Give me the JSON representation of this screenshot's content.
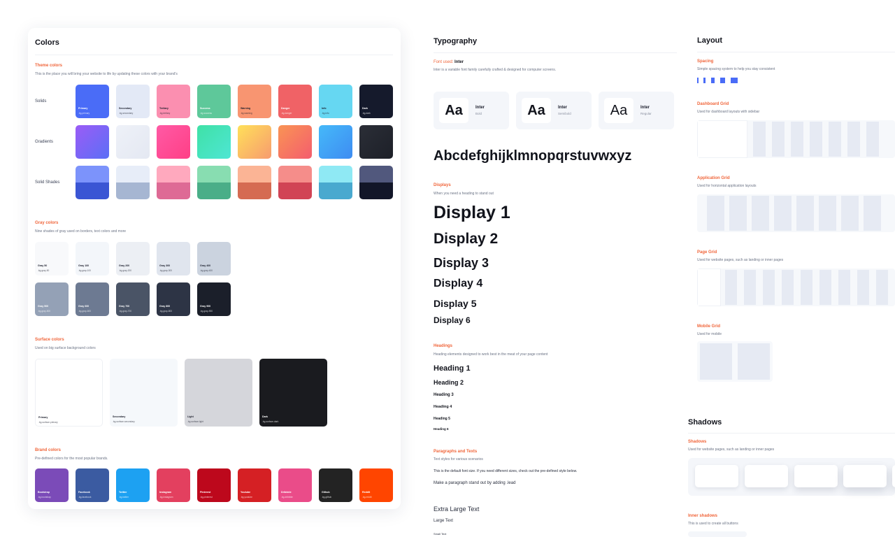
{
  "colors": {
    "title": "Colors",
    "theme": {
      "title": "Theme colors",
      "desc": "This is the place you will bring your website to life by updating these colors with your brand's",
      "row_labels": [
        "Solids",
        "Gradients",
        "Solid Shades"
      ],
      "solids": [
        {
          "name": "Primary",
          "code": ".bg-primary",
          "color": "#4a6cf7"
        },
        {
          "name": "Secondary",
          "code": ".bg-secondary",
          "color": "#e3e9f6"
        },
        {
          "name": "Tertiary",
          "code": ".bg-tertiary",
          "color": "#fb8fb0"
        },
        {
          "name": "Success",
          "code": ".bg-success",
          "color": "#5ec89a"
        },
        {
          "name": "Warning",
          "code": ".bg-warning",
          "color": "#f89571"
        },
        {
          "name": "Danger",
          "code": ".bg-danger",
          "color": "#f06266"
        },
        {
          "name": "Info",
          "code": ".bg-info",
          "color": "#66d7f2"
        },
        {
          "name": "Dark",
          "code": ".bg-dark",
          "color": "#151a2c"
        }
      ],
      "gradients": [
        {
          "from": "#9b5cf6",
          "to": "#5b6ff6"
        },
        {
          "from": "#eef1f8",
          "to": "#e4e8f2"
        },
        {
          "from": "#ff5aa5",
          "to": "#ff3f86"
        },
        {
          "from": "#3fe1a6",
          "to": "#4ee6d4"
        },
        {
          "from": "#ffe059",
          "to": "#f79b6f"
        },
        {
          "from": "#f99454",
          "to": "#f45d6e"
        },
        {
          "from": "#45b9f9",
          "to": "#3e8cf2"
        },
        {
          "from": "#2b2e37",
          "to": "#1d2028"
        }
      ],
      "shades": [
        {
          "top": "#7c93fb",
          "bottom": "#3a55d4"
        },
        {
          "top": "#e7edf8",
          "bottom": "#a6b6d2"
        },
        {
          "top": "#ffa9be",
          "bottom": "#de6a95"
        },
        {
          "top": "#88ddb1",
          "bottom": "#4aae88"
        },
        {
          "top": "#fbb495",
          "bottom": "#d56b52"
        },
        {
          "top": "#f58d8a",
          "bottom": "#d14455"
        },
        {
          "top": "#8fe9f4",
          "bottom": "#49a9cf"
        },
        {
          "top": "#51587d",
          "bottom": "#121628"
        }
      ]
    },
    "gray": {
      "title": "Gray colors",
      "desc": "Nine shades of gray used on borders, text colors and more",
      "items": [
        {
          "name": "Gray 50",
          "code": ".bg-gray-50",
          "color": "#f8f9fb"
        },
        {
          "name": "Gray 100",
          "code": ".bg-gray-100",
          "color": "#f3f6fa"
        },
        {
          "name": "Gray 200",
          "code": ".bg-gray-200",
          "color": "#eceff4"
        },
        {
          "name": "Gray 300",
          "code": ".bg-gray-300",
          "color": "#e0e5ee"
        },
        {
          "name": "Gray 400",
          "code": ".bg-gray-400",
          "color": "#cbd3df"
        },
        {
          "name": "Gray 500",
          "code": ".bg-gray-500",
          "color": "#94a1b6"
        },
        {
          "name": "Gray 600",
          "code": ".bg-gray-600",
          "color": "#6d7a92"
        },
        {
          "name": "Gray 700",
          "code": ".bg-gray-700",
          "color": "#4a5466"
        },
        {
          "name": "Gray 800",
          "code": ".bg-gray-800",
          "color": "#2d3445"
        },
        {
          "name": "Gray 900",
          "code": ".bg-gray-900",
          "color": "#1b1f2a"
        }
      ]
    },
    "surface": {
      "title": "Surface colors",
      "desc": "Used on big surface background colors",
      "items": [
        {
          "name": "Primary",
          "code": ".bg-surface-primary",
          "color": "#ffffff"
        },
        {
          "name": "Secondary",
          "code": ".bg-surface-secondary",
          "color": "#f5f8fb"
        },
        {
          "name": "Light",
          "code": ".bg-surface-light",
          "color": "#d5d6db"
        },
        {
          "name": "Dark",
          "code": ".bg-surface-dark",
          "color": "#1a1b1f"
        }
      ]
    },
    "brand": {
      "title": "Brand colors",
      "desc": "Pre-defined colors for the most popular brands.",
      "items": [
        {
          "name": "Bootstrap",
          "code": ".bg-bootstrap",
          "color": "#7b4bb8"
        },
        {
          "name": "Facebook",
          "code": ".bg-facebook",
          "color": "#3b5ba1"
        },
        {
          "name": "Twitter",
          "code": ".bg-twitter",
          "color": "#1da1f2"
        },
        {
          "name": "Instagram",
          "code": ".bg-instagram",
          "color": "#e3405f"
        },
        {
          "name": "Pinterest",
          "code": ".bg-pinterest",
          "color": "#bd081c"
        },
        {
          "name": "Youtube",
          "code": ".bg-youtube",
          "color": "#d52024"
        },
        {
          "name": "Dribbble",
          "code": ".bg-dribbble",
          "color": "#ea4c89"
        },
        {
          "name": "Github",
          "code": ".bg-github",
          "color": "#232323"
        },
        {
          "name": "Reddit",
          "code": ".bg-reddit",
          "color": "#ff4500"
        }
      ]
    }
  },
  "typography": {
    "title": "Typography",
    "font_used_label": "Font used:",
    "font_used_name": "Inter",
    "font_desc": "Inter is a variable font family carefully crafted & designed for computer screens.",
    "cards": [
      {
        "aa": "Aa",
        "name": "Inter",
        "weight": "Bold"
      },
      {
        "aa": "Aa",
        "name": "Inter",
        "weight": "Semibold"
      },
      {
        "aa": "Aa",
        "name": "Inter",
        "weight": "Regular"
      }
    ],
    "alphabet": "Abcdefghijklmnopqrstuvwxyz",
    "displays_title": "Displays",
    "displays_desc": "When you need a heading to stand out",
    "displays": [
      "Display 1",
      "Display 2",
      "Display 3",
      "Display 4",
      "Display 5",
      "Display 6"
    ],
    "headings_title": "Headings",
    "headings_desc": "Heading elements designed to work best in the meat of your page content",
    "headings": [
      "Heading 1",
      "Heading 2",
      "Heading 3",
      "Heading 4",
      "Heading 5",
      "Heading 6"
    ],
    "paragraphs_title": "Paragraphs and Texts",
    "paragraphs_desc": "Text styles for various scenarios",
    "para_default": "This is the default font size. If you need different sizes, check out the pre-defined style below.",
    "para_lead": "Make a paragraph stand out by adding .lead",
    "xl_text": "Extra Large Text",
    "large_text": "Large Text",
    "small_text": "Small Text"
  },
  "layout": {
    "title": "Layout",
    "spacing_title": "Spacing",
    "spacing_desc": "Simple spacing system to help you stay consistent",
    "dashboard_title": "Dashboard Grid",
    "dashboard_desc": "Used for dashboard layouts with sidebar",
    "application_title": "Application Grid",
    "application_desc": "Used for horizontal application layouts",
    "page_title": "Page Grid",
    "page_desc": "Used for website pages, such as landing or inner pages",
    "mobile_title": "Mobile Grid",
    "mobile_desc": "Used for mobile"
  },
  "shadows": {
    "title": "Shadows",
    "shadows_title": "Shadows",
    "shadows_desc": "Used for website pages, such as landing or inner pages",
    "inner_title": "Inner shadows",
    "inner_desc": "This is used to create all buttons"
  }
}
